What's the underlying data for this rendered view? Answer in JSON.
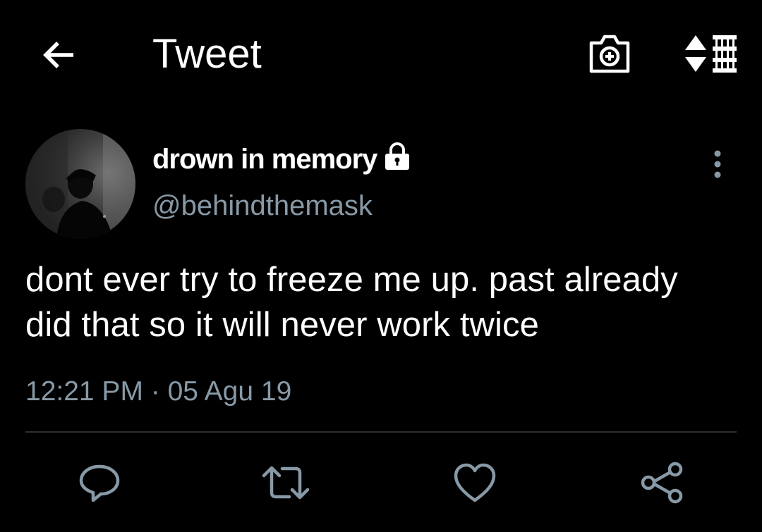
{
  "header": {
    "title": "Tweet",
    "back_icon": "arrow-left-icon",
    "camera_icon": "camera-plus-icon",
    "sort_icon": "sort-list-icon"
  },
  "tweet": {
    "author": {
      "display_name": "drown in memory",
      "handle": "@behindthemask",
      "protected_icon": "lock-icon"
    },
    "text_lines": [
      "dont ever try to freeze me up. past already",
      "did that so it will never work twice"
    ],
    "time": "12:21 PM",
    "separator": "·",
    "date": "05 Agu 19",
    "timestamp": "12:21 PM · 05 Agu 19"
  },
  "actions": [
    {
      "name": "reply",
      "icon": "reply-icon"
    },
    {
      "name": "retweet",
      "icon": "retweet-icon"
    },
    {
      "name": "like",
      "icon": "heart-icon"
    },
    {
      "name": "share",
      "icon": "share-icon"
    }
  ],
  "colors": {
    "background": "#000000",
    "primary_text": "#ffffff",
    "secondary_text": "#8899a6",
    "divider": "#2a2f34"
  }
}
